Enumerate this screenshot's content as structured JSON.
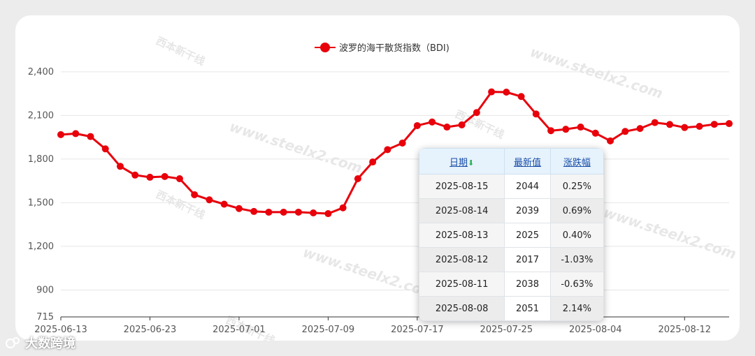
{
  "legend": {
    "label": "波罗的海干散货指数（BDI)"
  },
  "watermarks": {
    "domain": "www.steelx2.com",
    "logo_text": "西本新干线"
  },
  "colors": {
    "series": "#e8000b",
    "up": "#e8000b",
    "down": "#14a014",
    "grid": "#e6e6e6",
    "axis_text": "#555555"
  },
  "chart_data": {
    "type": "line",
    "x": [
      "2025-06-13",
      "2025-06-16",
      "2025-06-17",
      "2025-06-18",
      "2025-06-19",
      "2025-06-20",
      "2025-06-23",
      "2025-06-24",
      "2025-06-25",
      "2025-06-26",
      "2025-06-27",
      "2025-06-30",
      "2025-07-01",
      "2025-07-02",
      "2025-07-03",
      "2025-07-04",
      "2025-07-07",
      "2025-07-08",
      "2025-07-09",
      "2025-07-10",
      "2025-07-11",
      "2025-07-14",
      "2025-07-15",
      "2025-07-16",
      "2025-07-17",
      "2025-07-18",
      "2025-07-21",
      "2025-07-22",
      "2025-07-23",
      "2025-07-24",
      "2025-07-25",
      "2025-07-28",
      "2025-07-29",
      "2025-07-30",
      "2025-07-31",
      "2025-08-01",
      "2025-08-04",
      "2025-08-05",
      "2025-08-06",
      "2025-08-07",
      "2025-08-08",
      "2025-08-11",
      "2025-08-12",
      "2025-08-13",
      "2025-08-14",
      "2025-08-15"
    ],
    "series": [
      {
        "values": [
          1968,
          1975,
          1955,
          1870,
          1750,
          1690,
          1675,
          1680,
          1665,
          1555,
          1520,
          1490,
          1460,
          1440,
          1435,
          1435,
          1435,
          1430,
          1425,
          1465,
          1665,
          1780,
          1865,
          1910,
          2030,
          2055,
          2020,
          2035,
          2120,
          2262,
          2260,
          2230,
          2110,
          1995,
          2005,
          2020,
          1978,
          1925,
          1990,
          2010,
          2051,
          2038,
          2017,
          2025,
          2039,
          2044
        ]
      }
    ],
    "xticks": [
      "2025-06-13",
      "2025-06-23",
      "2025-07-01",
      "2025-07-09",
      "2025-07-17",
      "2025-07-25",
      "2025-08-04",
      "2025-08-12"
    ],
    "yticks": [
      900,
      1200,
      1500,
      1800,
      2100,
      2400
    ],
    "yticks_labels": [
      "900",
      "1,200",
      "1,500",
      "1,800",
      "2,100",
      "2,400"
    ],
    "ymin_label": "715",
    "ylim": [
      715,
      2500
    ],
    "grid": true,
    "legend_position": "top-center"
  },
  "table": {
    "headers": {
      "date": "日期",
      "value": "最新值",
      "change": "涨跌幅"
    },
    "sort_arrow": "⬇",
    "rows": [
      {
        "date": "2025-08-15",
        "value": "2044",
        "change": "0.25%",
        "dir": "up"
      },
      {
        "date": "2025-08-14",
        "value": "2039",
        "change": "0.69%",
        "dir": "up"
      },
      {
        "date": "2025-08-13",
        "value": "2025",
        "change": "0.40%",
        "dir": "up"
      },
      {
        "date": "2025-08-12",
        "value": "2017",
        "change": "-1.03%",
        "dir": "down"
      },
      {
        "date": "2025-08-11",
        "value": "2038",
        "change": "-0.63%",
        "dir": "down"
      },
      {
        "date": "2025-08-08",
        "value": "2051",
        "change": "2.14%",
        "dir": "up"
      }
    ]
  },
  "brand": {
    "text": "大数跨境"
  }
}
